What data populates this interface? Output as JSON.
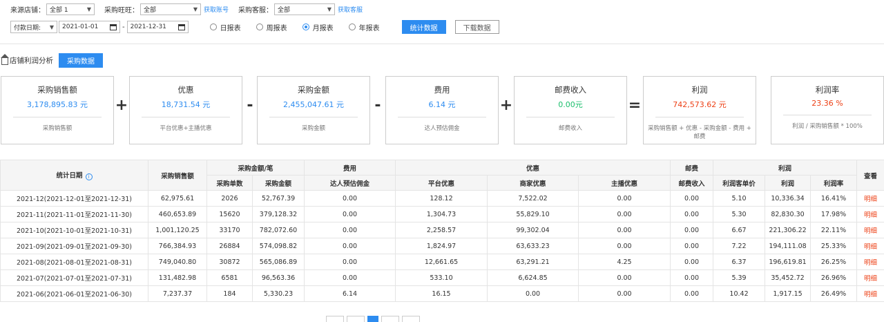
{
  "filters": {
    "source_store_label": "来源店铺：",
    "source_store_value": "全部 1",
    "wangwang_label": "采购旺旺：",
    "wangwang_value": "全部",
    "get_account_link": "获取账号",
    "service_label": "采购客服：",
    "service_value": "全部",
    "get_service_link": "获取客服",
    "date_type_value": "付款日期:",
    "date_start": "2021-01-01",
    "date_sep": "-",
    "date_end": "2021-12-31",
    "radios": [
      {
        "label": "日报表",
        "checked": false
      },
      {
        "label": "周报表",
        "checked": false
      },
      {
        "label": "月报表",
        "checked": true
      },
      {
        "label": "年报表",
        "checked": false
      }
    ],
    "stat_button": "统计数据",
    "download_button": "下载数据"
  },
  "section": {
    "title": "店铺利润分析",
    "tab_button": "采购数据"
  },
  "cards": [
    {
      "title": "采购销售额",
      "value": "3,178,895.83 元",
      "note": "采购销售额",
      "color": "#2d8cf0"
    },
    {
      "title": "优惠",
      "value": "18,731.54 元",
      "note": "平台优惠+主播优惠",
      "color": "#2d8cf0"
    },
    {
      "title": "采购金额",
      "value": "2,455,047.61 元",
      "note": "采购金额",
      "color": "#2d8cf0"
    },
    {
      "title": "费用",
      "value": "6.14 元",
      "note": "达人预估佣金",
      "color": "#2d8cf0"
    },
    {
      "title": "邮费收入",
      "value": "0.00元",
      "note": "邮费收入",
      "color": "#19be6b"
    },
    {
      "title": "利润",
      "value": "742,573.62 元",
      "note": "采购销售额 + 优惠 - 采购金额 - 费用 + 邮费",
      "color": "#ed3f14"
    },
    {
      "title": "利润率",
      "value": "23.36 %",
      "note": "利润 / 采购销售额 * 100%",
      "color": "#ed3f14"
    }
  ],
  "operators": [
    "+",
    "-",
    "-",
    "+",
    "="
  ],
  "table": {
    "group_headers": {
      "date": "统计日期",
      "sales": "采购销售额",
      "purchase": "采购金额/笔",
      "fee": "费用",
      "discount": "优惠",
      "postage": "邮费",
      "profit": "利润",
      "view": "查看"
    },
    "sub_headers": {
      "count": "采购单数",
      "amount": "采购金额",
      "commission": "达人预估佣金",
      "platform": "平台优惠",
      "merchant": "商家优惠",
      "anchor": "主播优惠",
      "postage_income": "邮费收入",
      "unit_price": "利润客单价",
      "profit": "利润",
      "rate": "利润率"
    },
    "rows": [
      [
        "2021-12(2021-12-01至2021-12-31)",
        "62,975.61",
        "2026",
        "52,767.39",
        "0.00",
        "128.12",
        "7,522.02",
        "0.00",
        "0.00",
        "5.10",
        "10,336.34",
        "16.41%",
        "明细"
      ],
      [
        "2021-11(2021-11-01至2021-11-30)",
        "460,653.89",
        "15620",
        "379,128.32",
        "0.00",
        "1,304.73",
        "55,829.10",
        "0.00",
        "0.00",
        "5.30",
        "82,830.30",
        "17.98%",
        "明细"
      ],
      [
        "2021-10(2021-10-01至2021-10-31)",
        "1,001,120.25",
        "33170",
        "782,072.60",
        "0.00",
        "2,258.57",
        "99,302.04",
        "0.00",
        "0.00",
        "6.67",
        "221,306.22",
        "22.11%",
        "明细"
      ],
      [
        "2021-09(2021-09-01至2021-09-30)",
        "766,384.93",
        "26884",
        "574,098.82",
        "0.00",
        "1,824.97",
        "63,633.23",
        "0.00",
        "0.00",
        "7.22",
        "194,111.08",
        "25.33%",
        "明细"
      ],
      [
        "2021-08(2021-08-01至2021-08-31)",
        "749,040.80",
        "30872",
        "565,086.89",
        "0.00",
        "12,661.65",
        "63,291.21",
        "4.25",
        "0.00",
        "6.37",
        "196,619.81",
        "26.25%",
        "明细"
      ],
      [
        "2021-07(2021-07-01至2021-07-31)",
        "131,482.98",
        "6581",
        "96,563.36",
        "0.00",
        "533.10",
        "6,624.85",
        "0.00",
        "0.00",
        "5.39",
        "35,452.72",
        "26.96%",
        "明细"
      ],
      [
        "2021-06(2021-06-01至2021-06-30)",
        "7,237.37",
        "184",
        "5,330.23",
        "6.14",
        "16.15",
        "0.00",
        "0.00",
        "0.00",
        "10.42",
        "1,917.15",
        "26.49%",
        "明细"
      ]
    ]
  }
}
